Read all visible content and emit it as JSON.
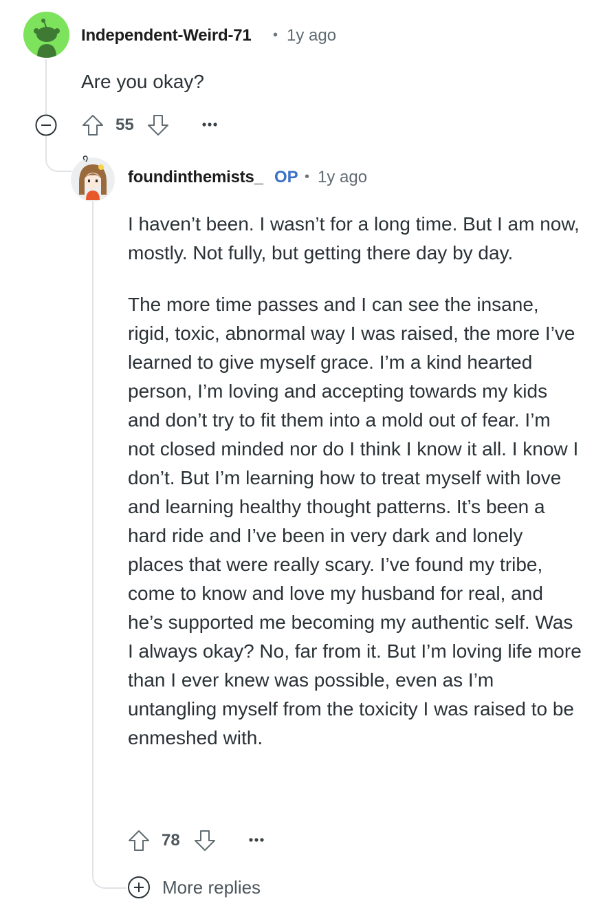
{
  "colors": {
    "background": "#ffffff",
    "text": "#2a3236",
    "thread_line": "#dfe3e6",
    "op_badge": "#3a71c7",
    "avatar_green": "#7ee35c"
  },
  "parent_comment": {
    "username": "Independent-Weird-71",
    "separator": "•",
    "timestamp": "1y ago",
    "avatar_icon": "reddit-snoo-avatar-icon",
    "text": "Are you okay?",
    "vote_count": "55",
    "collapse_icon": "minus-circle-icon",
    "upvote_icon": "upvote-arrow-icon",
    "downvote_icon": "downvote-arrow-icon",
    "more_icon": "more-options-icon"
  },
  "reply_comment": {
    "username": "foundinthemists_",
    "op_label": "OP",
    "separator": "•",
    "timestamp": "1y ago",
    "avatar_icon": "custom-character-avatar-icon",
    "paragraphs": [
      "I haven’t been. I wasn’t for a long time. But I am now, mostly. Not fully, but getting there day by day.",
      "The more time passes and I can see the insane, rigid, toxic, abnormal way I was raised, the more I’ve learned to give myself grace. I’m a kind hearted person, I’m loving and accepting towards my kids and don’t try to fit them into a mold out of fear. I’m not closed minded nor do I think I know it all. I know I don’t. But I’m learning how to treat myself with love and learning healthy thought patterns. It’s been a hard ride and I’ve been in very dark and lonely places that were really scary. I’ve found my tribe, come to know and love my husband for real, and he’s supported me becoming my authentic self. Was I always okay? No, far from it. But I’m loving life more than I ever knew was possible, even as I’m untangling myself from the toxicity I was raised to be enmeshed with."
    ],
    "vote_count": "78"
  },
  "more_replies": {
    "label": "More replies",
    "icon": "plus-circle-icon"
  }
}
